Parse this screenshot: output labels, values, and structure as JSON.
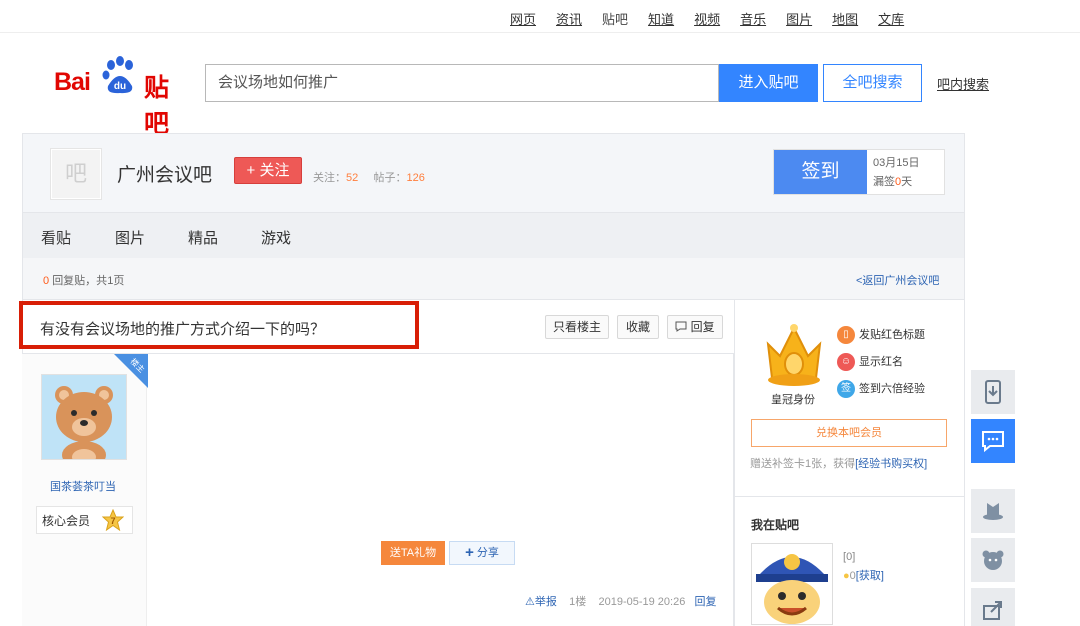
{
  "topnav": {
    "items": [
      "网页",
      "资讯",
      "贴吧",
      "知道",
      "视频",
      "音乐",
      "图片",
      "地图",
      "文库"
    ],
    "current": "贴吧"
  },
  "logo": {
    "part1": "Bai",
    "part2": "du",
    "part3": "贴吧"
  },
  "search": {
    "value": "会议场地如何推广",
    "enter_label": "进入贴吧",
    "all_label": "全吧搜索",
    "inner_link": "吧内搜索"
  },
  "forum": {
    "avatar_glyph": "吧",
    "name": "广州会议吧",
    "follow_label": "+ 关注",
    "follow_count_label": "关注：",
    "follow_count": "52",
    "post_count_label": "帖子：",
    "post_count": "126",
    "signin_label": "签到",
    "signin_date": "03月15日",
    "missed_label": "漏签",
    "missed_days": "0",
    "missed_unit": "天"
  },
  "tabs": [
    "看贴",
    "图片",
    "精品",
    "游戏"
  ],
  "replybar": {
    "reply_count": "0",
    "reply_text": "回复贴，共",
    "pages": "1",
    "page_unit": "页",
    "back_link": "<返回广州会议吧"
  },
  "post": {
    "title": "有没有会议场地的推广方式介绍一下的吗？",
    "only_op_label": "只看楼主",
    "favorite_label": "收藏",
    "reply_label": "回复",
    "op_badge": "楼主",
    "author": "国茶荟茶叮当",
    "member_label": "核心会员",
    "member_level": "7",
    "gift_label": "送TA礼物",
    "share_label": "分享",
    "report_label": "举报",
    "floor": "1楼",
    "timestamp": "2019-05-19 20:26",
    "reply_link": "回复"
  },
  "sidebar": {
    "crown_label": "皇冠身份",
    "perks": [
      "发贴红色标题",
      "显示红名",
      "签到六倍经验"
    ],
    "perk_icon_glyph": "签",
    "exchange_label": "兑换本吧会员",
    "bonus_text": "赠送补签卡1张，获得",
    "bonus_link": "[经验书购买权]",
    "me_title": "我在贴吧",
    "me_score": "0",
    "me_get": "[获取]",
    "me_level_glyph": "0"
  },
  "float_toolbar": [
    "download-app",
    "message",
    "hat",
    "bear",
    "share"
  ],
  "colors": {
    "brand_red": "#e10602",
    "accent_blue": "#3385ff",
    "follow_red": "#ee5956",
    "highlight_red": "#d81e06",
    "orange": "#f5873c"
  }
}
